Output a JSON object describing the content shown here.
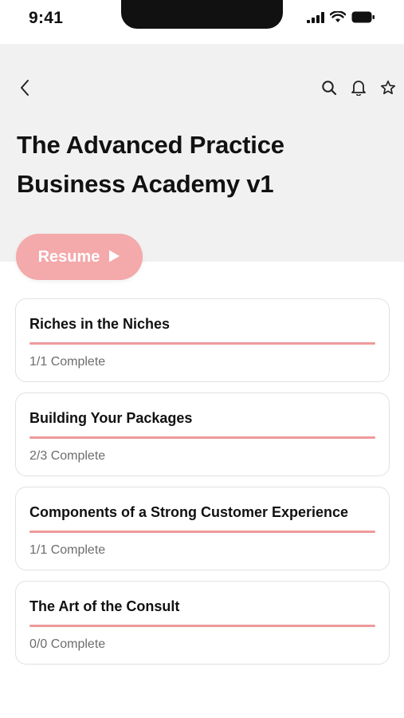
{
  "status_bar": {
    "time": "9:41",
    "icons": [
      "signal-icon",
      "wifi-icon",
      "battery-icon"
    ]
  },
  "header": {
    "back_icon": "chevron-left-icon",
    "actions": [
      "search-icon",
      "bell-icon",
      "star-icon"
    ],
    "title": "The Advanced Practice Business Academy v1"
  },
  "resume": {
    "label": "Resume",
    "icon": "play-icon",
    "color": "#f4a9ab"
  },
  "colors": {
    "accent": "#ee9a9c",
    "header_bg": "#f1f1f1"
  },
  "courses": [
    {
      "title": "Riches in the Niches",
      "status": "1/1 Complete",
      "progress": 1.0
    },
    {
      "title": "Building Your Packages",
      "status": "2/3 Complete",
      "progress": 1.0
    },
    {
      "title": "Components of a Strong Customer Experience",
      "status": "1/1 Complete",
      "progress": 1.0
    },
    {
      "title": "The Art of the Consult",
      "status": "0/0 Complete",
      "progress": 1.0
    }
  ]
}
